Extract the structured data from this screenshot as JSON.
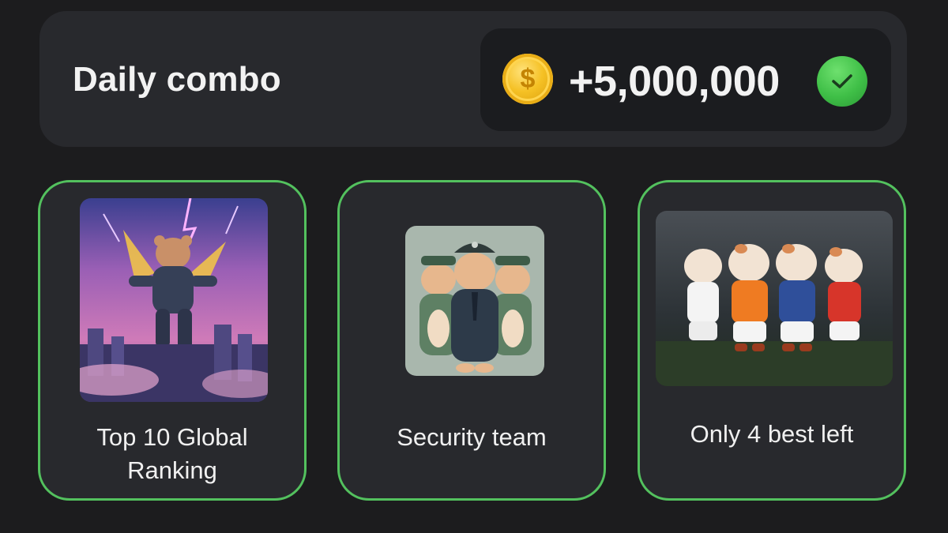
{
  "header": {
    "title": "Daily combo",
    "reward": {
      "coin_icon": "dollar-coin-icon",
      "coin_symbol": "$",
      "amount": "+5,000,000",
      "status_icon": "check-circle-icon"
    }
  },
  "cards": [
    {
      "label_line1": "Top 10 Global",
      "label_line2": "Ranking",
      "image": "flying-hamster-astronaut"
    },
    {
      "label_line1": "Security team",
      "image": "hamster-security-guards"
    },
    {
      "label_line1": "Only 4 best left",
      "image": "hamster-football-team"
    }
  ],
  "colors": {
    "background": "#1c1c1e",
    "panel": "#28292d",
    "card_border": "#53c15e",
    "coin": "#f5c125",
    "check": "#3fbf47"
  }
}
